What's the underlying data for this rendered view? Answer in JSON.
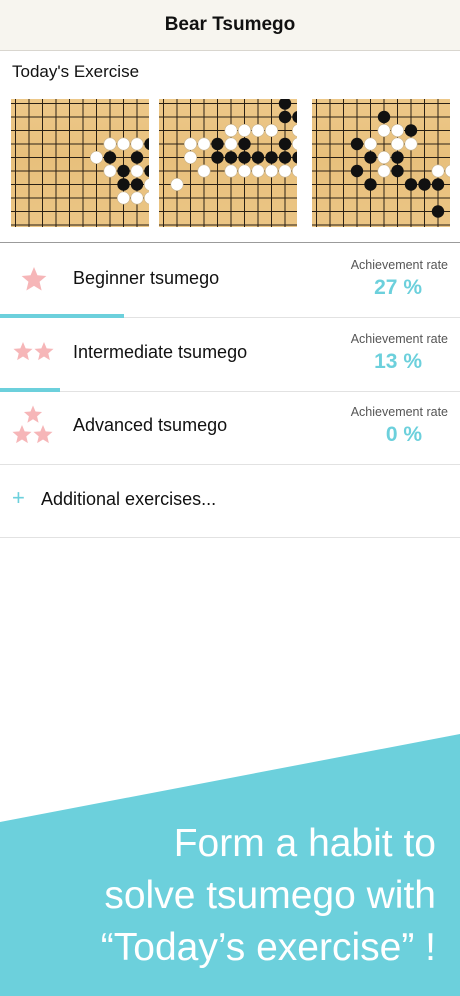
{
  "nav": {
    "title": "Bear Tsumego"
  },
  "todays_exercise": {
    "title": "Today's Exercise"
  },
  "courses": [
    {
      "label": "Beginner tsumego",
      "rate_caption": "Achievement rate",
      "rate": "27 %",
      "progress": 0.27,
      "stars": 1
    },
    {
      "label": "Intermediate tsumego",
      "rate_caption": "Achievement rate",
      "rate": "13 %",
      "progress": 0.13,
      "stars": 2
    },
    {
      "label": "Advanced tsumego",
      "rate_caption": "Achievement rate",
      "rate": "0 %",
      "progress": 0.0,
      "stars": 3
    }
  ],
  "additional": {
    "plus": "+",
    "label": "Additional exercises..."
  },
  "promo": {
    "line1": "Form a habit to",
    "line2": "solve tsumego with",
    "line3": "“Today’s exercise” !"
  },
  "colors": {
    "accent": "#6cd0dc",
    "star": "#f6b6b8",
    "board": "#e9c27f",
    "nav_bg": "#f7f5ef"
  },
  "icons": {
    "star": "star-icon",
    "plus": "plus-icon"
  },
  "boards": [
    {
      "white": [
        [
          7,
          3
        ],
        [
          8,
          3
        ],
        [
          9,
          3
        ],
        [
          6,
          4
        ],
        [
          7,
          5
        ],
        [
          9,
          5
        ],
        [
          10,
          6
        ],
        [
          8,
          7
        ],
        [
          9,
          7
        ],
        [
          10,
          7
        ]
      ],
      "black": [
        [
          10,
          3
        ],
        [
          7,
          4
        ],
        [
          9,
          4
        ],
        [
          8,
          5
        ],
        [
          10,
          5
        ],
        [
          8,
          6
        ],
        [
          9,
          6
        ]
      ]
    },
    {
      "white": [
        [
          5,
          2
        ],
        [
          6,
          2
        ],
        [
          7,
          2
        ],
        [
          8,
          2
        ],
        [
          10,
          2
        ],
        [
          11,
          2
        ],
        [
          12,
          2
        ],
        [
          2,
          3
        ],
        [
          3,
          3
        ],
        [
          5,
          3
        ],
        [
          10,
          3
        ],
        [
          11,
          3
        ],
        [
          2,
          4
        ],
        [
          11,
          4
        ],
        [
          5,
          5
        ],
        [
          6,
          5
        ],
        [
          7,
          5
        ],
        [
          8,
          5
        ],
        [
          9,
          5
        ],
        [
          10,
          5
        ],
        [
          11,
          5
        ],
        [
          3,
          5
        ],
        [
          1,
          6
        ]
      ],
      "black": [
        [
          9,
          0
        ],
        [
          9,
          1
        ],
        [
          10,
          1
        ],
        [
          4,
          3
        ],
        [
          6,
          3
        ],
        [
          9,
          3
        ],
        [
          4,
          4
        ],
        [
          5,
          4
        ],
        [
          6,
          4
        ],
        [
          7,
          4
        ],
        [
          8,
          4
        ],
        [
          9,
          4
        ],
        [
          10,
          4
        ]
      ]
    },
    {
      "white": [
        [
          5,
          2
        ],
        [
          6,
          2
        ],
        [
          4,
          3
        ],
        [
          6,
          3
        ],
        [
          7,
          3
        ],
        [
          5,
          4
        ],
        [
          5,
          5
        ],
        [
          9,
          5
        ],
        [
          10,
          5
        ]
      ],
      "black": [
        [
          5,
          1
        ],
        [
          7,
          2
        ],
        [
          3,
          3
        ],
        [
          4,
          4
        ],
        [
          6,
          4
        ],
        [
          3,
          5
        ],
        [
          6,
          5
        ],
        [
          4,
          6
        ],
        [
          7,
          6
        ],
        [
          8,
          6
        ],
        [
          9,
          6
        ],
        [
          9,
          8
        ]
      ]
    }
  ]
}
